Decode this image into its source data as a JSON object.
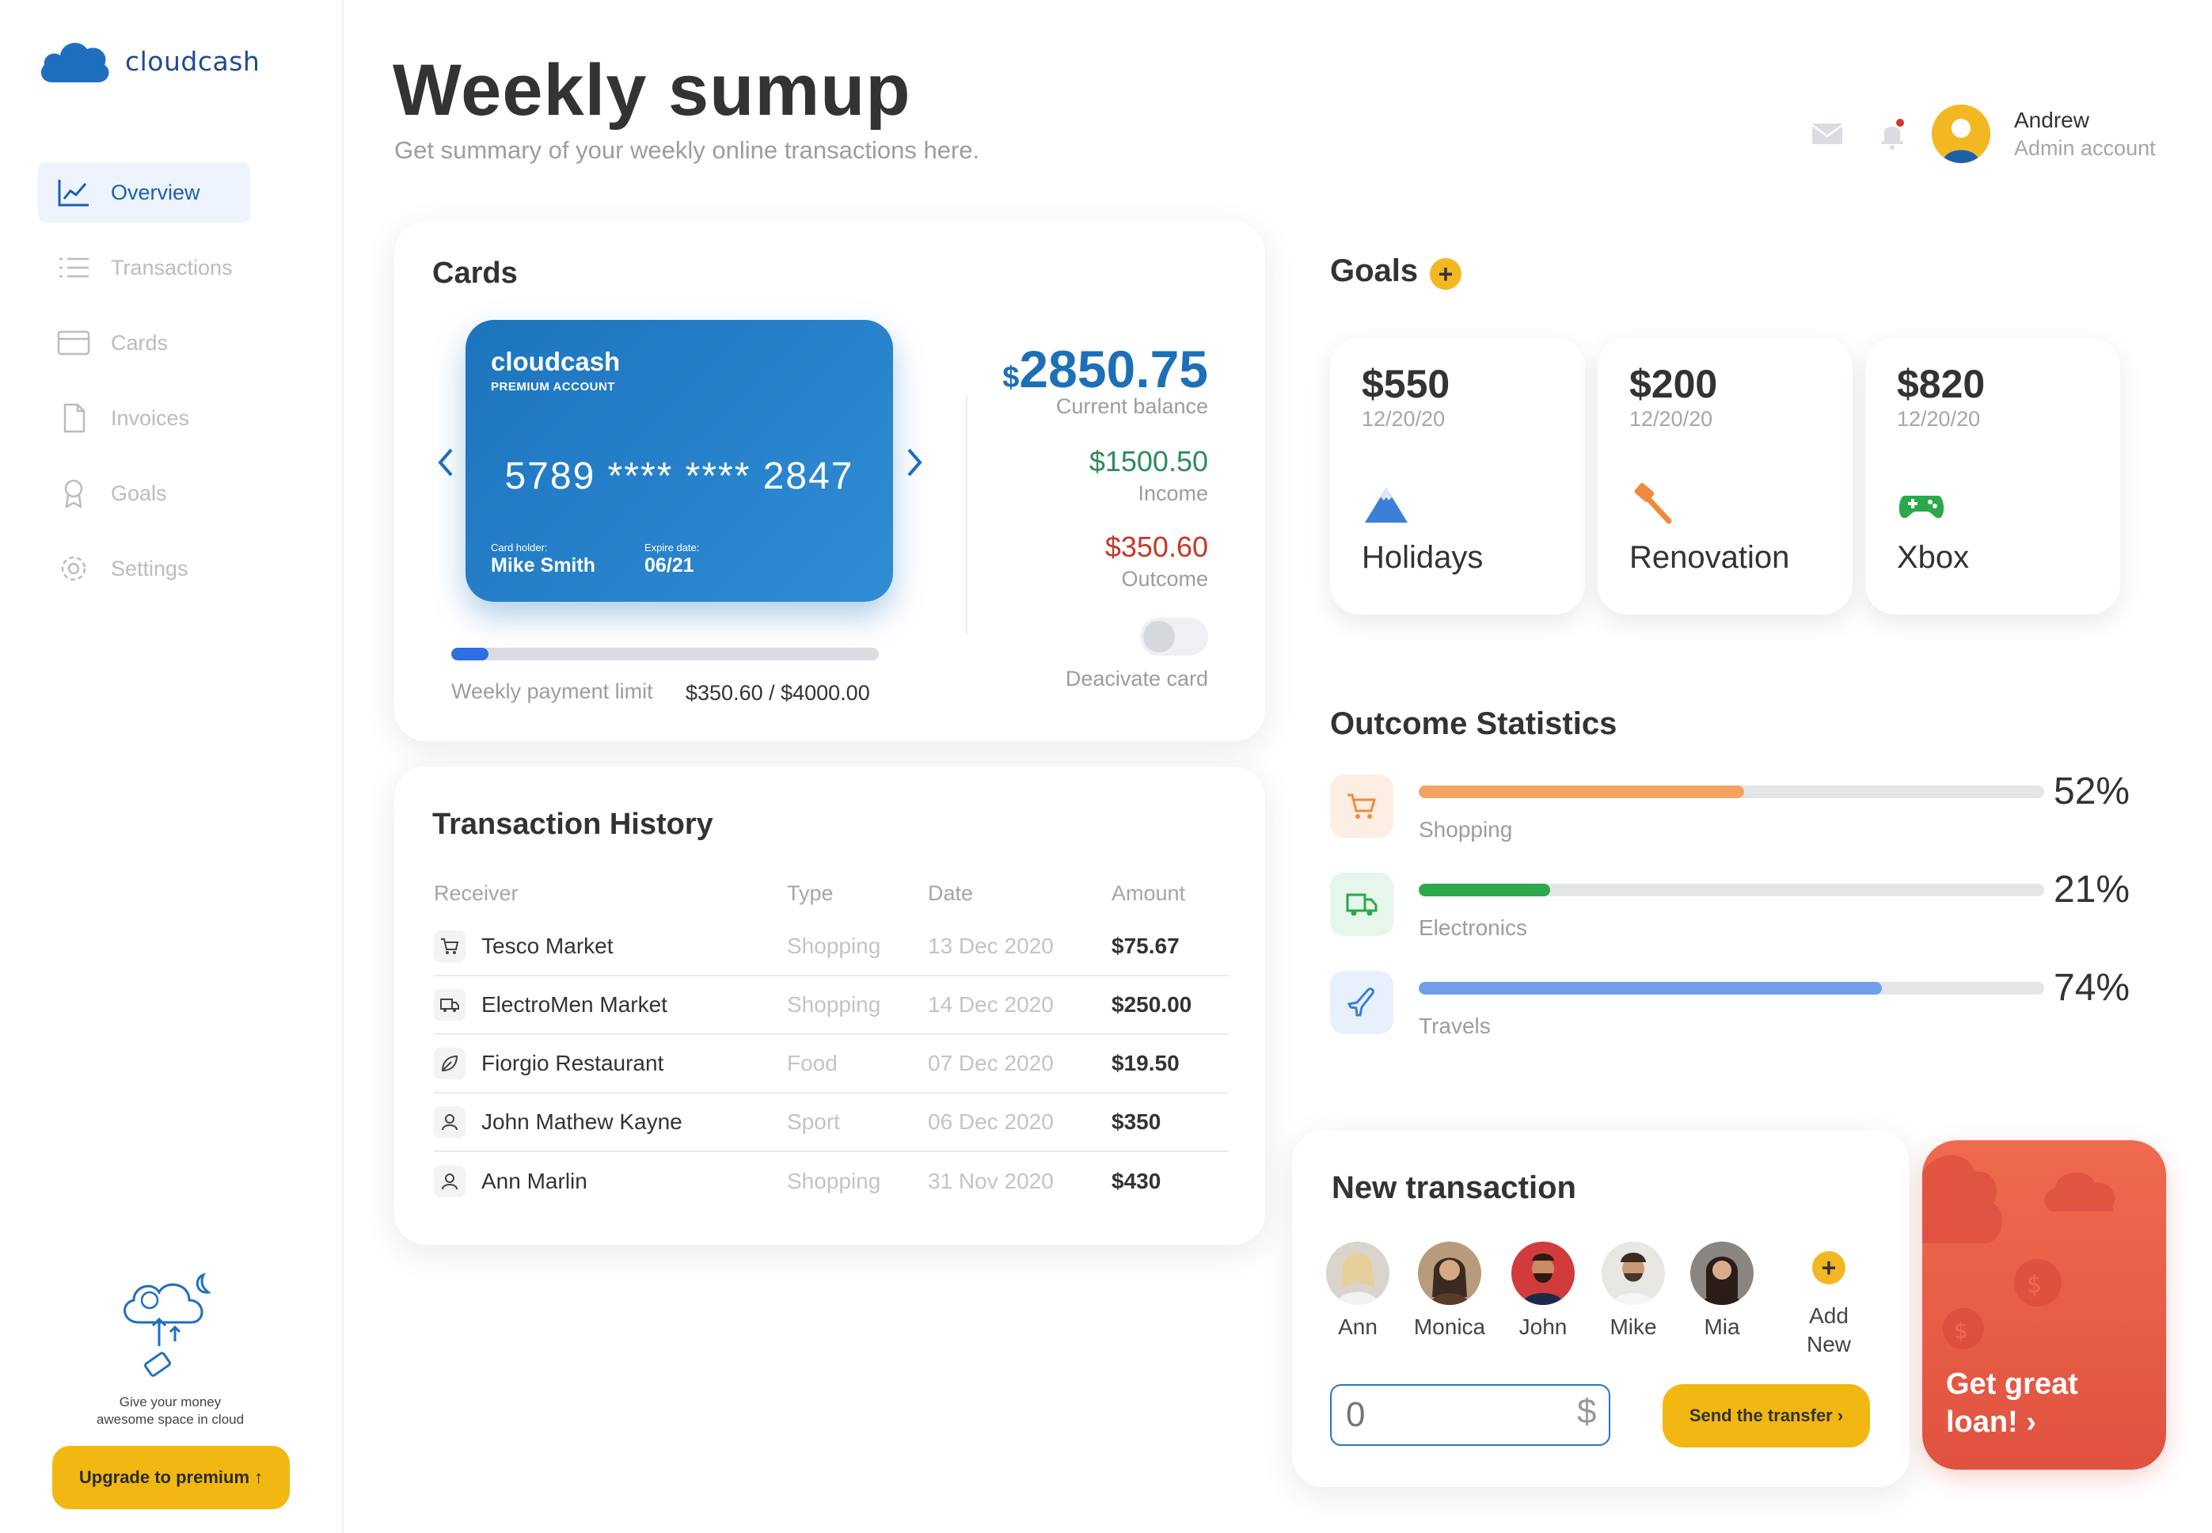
{
  "app": {
    "name": "cloudcash"
  },
  "sidebar": {
    "items": [
      {
        "label": "Overview",
        "icon": "chart-line-icon",
        "active": true
      },
      {
        "label": "Transactions",
        "icon": "list-icon",
        "active": false
      },
      {
        "label": "Cards",
        "icon": "credit-card-icon",
        "active": false
      },
      {
        "label": "Invoices",
        "icon": "document-icon",
        "active": false
      },
      {
        "label": "Goals",
        "icon": "award-icon",
        "active": false
      },
      {
        "label": "Settings",
        "icon": "gear-icon",
        "active": false
      }
    ],
    "promo_line1": "Give your money",
    "promo_line2": "awesome space in cloud",
    "upgrade_label": "Upgrade to premium ↑"
  },
  "header": {
    "title": "Weekly sumup",
    "subtitle": "Get summary of your weekly online transactions here.",
    "user_name": "Andrew",
    "user_role": "Admin account"
  },
  "cards": {
    "title": "Cards",
    "card": {
      "brand": "cloudcash",
      "tier": "PREMIUM ACCOUNT",
      "number": "5789 **** **** 2847",
      "holder_label": "Card holder:",
      "holder": "Mike Smith",
      "expiry_label": "Expire date:",
      "expiry": "06/21"
    },
    "currency_symbol": "$",
    "balance": "2850.75",
    "balance_label": "Current balance",
    "income": "$1500.50",
    "income_label": "Income",
    "outcome": "$350.60",
    "outcome_label": "Outcome",
    "deactivate_label": "Deacivate card",
    "limit_label": "Weekly payment limit",
    "limit_value": "$350.60 / $4000.00",
    "limit_fraction": 0.0877
  },
  "transactions": {
    "title": "Transaction History",
    "columns": [
      "Receiver",
      "Type",
      "Date",
      "Amount"
    ],
    "rows": [
      {
        "receiver": "Tesco Market",
        "type": "Shopping",
        "date": "13 Dec 2020",
        "amount": "$75.67",
        "icon": "cart-icon"
      },
      {
        "receiver": "ElectroMen Market",
        "type": "Shopping",
        "date": "14 Dec 2020",
        "amount": "$250.00",
        "icon": "truck-icon"
      },
      {
        "receiver": "Fiorgio Restaurant",
        "type": "Food",
        "date": "07 Dec 2020",
        "amount": "$19.50",
        "icon": "leaf-icon"
      },
      {
        "receiver": "John Mathew Kayne",
        "type": "Sport",
        "date": "06 Dec 2020",
        "amount": "$350",
        "icon": "user-icon"
      },
      {
        "receiver": "Ann Marlin",
        "type": "Shopping",
        "date": "31 Nov 2020",
        "amount": "$430",
        "icon": "user-icon"
      }
    ]
  },
  "goals": {
    "title": "Goals",
    "add_label": "+",
    "items": [
      {
        "amount": "$550",
        "date": "12/20/20",
        "name": "Holidays",
        "icon": "mountain-icon"
      },
      {
        "amount": "$200",
        "date": "12/20/20",
        "name": "Renovation",
        "icon": "paint-brush-icon"
      },
      {
        "amount": "$820",
        "date": "12/20/20",
        "name": "Xbox",
        "icon": "gamepad-icon"
      }
    ]
  },
  "outcome_stats": {
    "title": "Outcome Statistics",
    "items": [
      {
        "label": "Shopping",
        "percent": "52%",
        "value": 52,
        "color": "#f4a261",
        "icon": "cart-icon"
      },
      {
        "label": "Electronics",
        "percent": "21%",
        "value": 21,
        "color": "#2ea84a",
        "icon": "truck-icon"
      },
      {
        "label": "Travels",
        "percent": "74%",
        "value": 74,
        "color": "#6f9fe6",
        "icon": "airplane-icon"
      }
    ]
  },
  "new_transaction": {
    "title": "New transaction",
    "people": [
      "Ann",
      "Monica",
      "John",
      "Mike",
      "Mia"
    ],
    "add_line1": "Add",
    "add_line2": "New",
    "add_plus": "+",
    "amount_placeholder": "0",
    "currency": "$",
    "send_label": "Send the transfer ›"
  },
  "loan": {
    "line1": "Get great",
    "line2": "loan! ›"
  },
  "colors": {
    "primary": "#1d6fb8",
    "accent": "#f1b812",
    "income": "#2e8b57",
    "outcome": "#c0392b",
    "loan": "#e8604a"
  }
}
